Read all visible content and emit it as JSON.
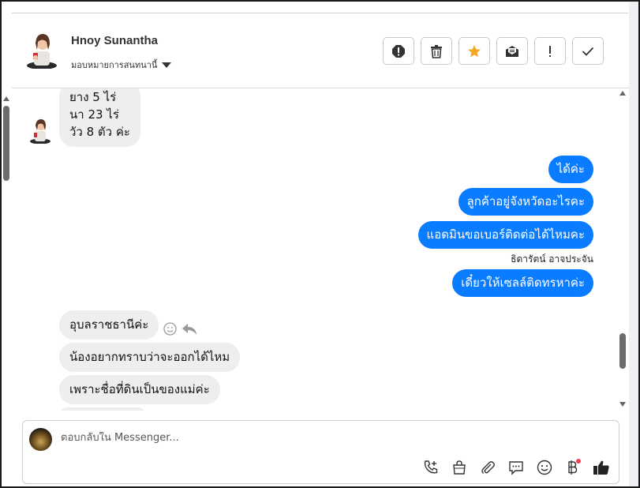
{
  "header": {
    "contact_name": "Hnoy Sunantha",
    "assign_label": "มอบหมายการสนทนานี้",
    "toolbar": [
      {
        "name": "spam-button",
        "icon": "alert-circle-icon",
        "label": "!"
      },
      {
        "name": "delete-button",
        "icon": "trash-icon"
      },
      {
        "name": "star-button",
        "icon": "star-icon"
      },
      {
        "name": "mark-unread-button",
        "icon": "envelope-icon"
      },
      {
        "name": "important-button",
        "icon": "exclamation-icon",
        "label": "!"
      },
      {
        "name": "done-button",
        "icon": "checkmark-icon"
      }
    ]
  },
  "messages": {
    "incoming_top": [
      "ยาง 5 ไร่",
      "นา 23 ไร่",
      "วัว 8 ตัว ค่ะ"
    ],
    "outgoing": [
      "ได้ค่ะ",
      "ลูกค้าอยู่จังหวัดอะไรคะ",
      "แอดมินขอเบอร์ติดต่อได้ไหมคะ",
      "เดี๋ยวให้เซลล์ติดทรหาค่ะ"
    ],
    "outgoing_sender": "ธิดารัตน์ อาจประจัน",
    "incoming_bottom": [
      "อุบลราชธานีค่ะ",
      "น้องอยากทราบว่าจะออกได้ไหม",
      "เพราะชื่อที่ดินเป็นของแม่ค่ะ"
    ]
  },
  "composer": {
    "placeholder": "ตอบกลับใน Messenger...",
    "tools": [
      "phone-plus-icon",
      "shopping-bag-icon",
      "paperclip-icon",
      "chat-bubble-icon",
      "smiley-icon",
      "baht-icon",
      "thumbs-up-icon"
    ]
  },
  "colors": {
    "outgoing_bubble": "#0a7cff",
    "incoming_bubble": "#eeeeee",
    "star": "#f5a623",
    "notification_dot": "#e8424f"
  }
}
